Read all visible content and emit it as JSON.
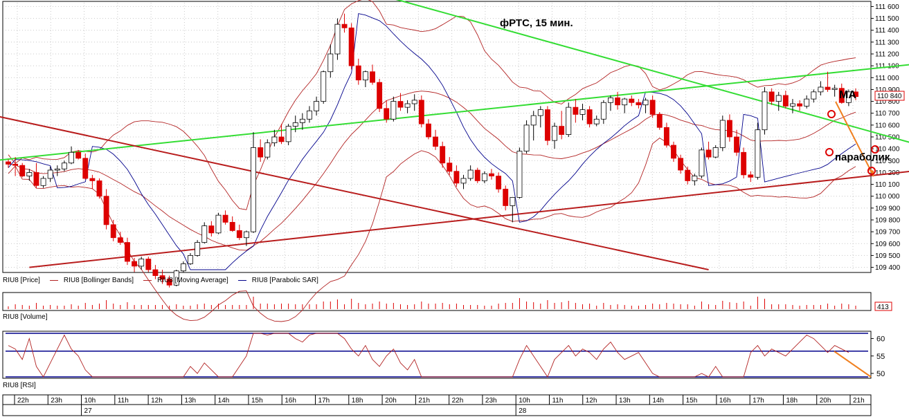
{
  "chart_title": "фРТС, 15 мин.",
  "annotations": {
    "ma": "MA",
    "parabolic": "параболик"
  },
  "price_panel": {
    "y_ticks": [
      "111 600",
      "111 500",
      "111 400",
      "111 300",
      "111 200",
      "111 100",
      "111 000",
      "110 900",
      "110 800",
      "110 700",
      "110 600",
      "110 500",
      "110 400",
      "110 300",
      "110 200",
      "110 100",
      "110 000",
      "109 900",
      "109 800",
      "109 700",
      "109 600",
      "109 500",
      "109 400"
    ],
    "last_price": "110 840",
    "legend": [
      {
        "label": "RIU8 [Price]",
        "color": "#000000"
      },
      {
        "label": "RIU8 [Bollinger Bands]",
        "color": "#b22222"
      },
      {
        "label": "RIU8 [Moving Average]",
        "color": "#b22222"
      },
      {
        "label": "RIU8 [Parabolic SAR]",
        "color": "#00008b"
      }
    ]
  },
  "volume_panel": {
    "label": "RIU8 [Volume]",
    "last_value": "413"
  },
  "rsi_panel": {
    "label": "RIU8 [RSI]",
    "y_ticks": [
      "60",
      "55",
      "50"
    ]
  },
  "time_axis": {
    "hours": [
      "22h",
      "23h",
      "10h",
      "11h",
      "12h",
      "13h",
      "14h",
      "15h",
      "16h",
      "17h",
      "18h",
      "20h",
      "21h",
      "22h",
      "23h",
      "10h",
      "11h",
      "12h",
      "13h",
      "14h",
      "15h",
      "16h",
      "17h",
      "18h",
      "20h",
      "21h"
    ],
    "days": [
      "27",
      "28"
    ]
  },
  "colors": {
    "up_candle": "#ffffff",
    "down_candle": "#dd0000",
    "bollinger": "#b22222",
    "sar": "#00008b",
    "trend_green": "#33dd33",
    "trend_red": "#b81c1c",
    "forecast": "#f08020",
    "rsi_line": "#b22222",
    "rsi_level": "#00008b"
  },
  "chart_data": {
    "type": "candlestick",
    "timeframe": "15 мин.",
    "ylim": [
      109380,
      111620
    ],
    "candles": [
      [
        110290,
        110310,
        110240,
        110270
      ],
      [
        110270,
        110330,
        110170,
        110260
      ],
      [
        110260,
        110280,
        110160,
        110170
      ],
      [
        110170,
        110230,
        110130,
        110200
      ],
      [
        110200,
        110280,
        110070,
        110090
      ],
      [
        110090,
        110170,
        110070,
        110150
      ],
      [
        110150,
        110250,
        110120,
        110220
      ],
      [
        110220,
        110260,
        110170,
        110230
      ],
      [
        110230,
        110300,
        110210,
        110280
      ],
      [
        110280,
        110420,
        110270,
        110370
      ],
      [
        110370,
        110390,
        110310,
        110320
      ],
      [
        110320,
        110360,
        110140,
        110150
      ],
      [
        110150,
        110180,
        110060,
        110130
      ],
      [
        110130,
        110150,
        109980,
        110000
      ],
      [
        110000,
        110060,
        109720,
        109760
      ],
      [
        109760,
        109800,
        109620,
        109650
      ],
      [
        109650,
        109700,
        109590,
        109610
      ],
      [
        109610,
        109650,
        109420,
        109450
      ],
      [
        109450,
        109480,
        109360,
        109410
      ],
      [
        109410,
        109490,
        109380,
        109470
      ],
      [
        109470,
        109490,
        109360,
        109380
      ],
      [
        109380,
        109420,
        109300,
        109330
      ],
      [
        109330,
        109380,
        109260,
        109300
      ],
      [
        109300,
        109330,
        109230,
        109250
      ],
      [
        109250,
        109380,
        109240,
        109370
      ],
      [
        109370,
        109450,
        109360,
        109430
      ],
      [
        109430,
        109520,
        109420,
        109500
      ],
      [
        109500,
        109630,
        109490,
        109610
      ],
      [
        109610,
        109780,
        109600,
        109750
      ],
      [
        109750,
        109790,
        109660,
        109690
      ],
      [
        109690,
        109860,
        109680,
        109840
      ],
      [
        109840,
        109880,
        109760,
        109780
      ],
      [
        109780,
        109830,
        109700,
        109710
      ],
      [
        109710,
        109760,
        109630,
        109650
      ],
      [
        109650,
        109710,
        109580,
        109700
      ],
      [
        109700,
        110540,
        109690,
        110410
      ],
      [
        110410,
        110480,
        110290,
        110330
      ],
      [
        110330,
        110480,
        110310,
        110450
      ],
      [
        110450,
        110560,
        110420,
        110500
      ],
      [
        110500,
        110610,
        110440,
        110460
      ],
      [
        110460,
        110610,
        110430,
        110590
      ],
      [
        110590,
        110680,
        110540,
        110620
      ],
      [
        110620,
        110700,
        110560,
        110650
      ],
      [
        110650,
        110760,
        110620,
        110720
      ],
      [
        110720,
        110840,
        110680,
        110800
      ],
      [
        110800,
        111060,
        110780,
        111050
      ],
      [
        111050,
        111280,
        111000,
        111200
      ],
      [
        111200,
        111500,
        111150,
        111450
      ],
      [
        111450,
        111540,
        111380,
        111420
      ],
      [
        111420,
        111460,
        111070,
        111100
      ],
      [
        111100,
        111160,
        110940,
        110980
      ],
      [
        110980,
        111060,
        110920,
        111050
      ],
      [
        111050,
        111110,
        110940,
        110960
      ],
      [
        110960,
        110990,
        110710,
        110740
      ],
      [
        110740,
        110810,
        110620,
        110650
      ],
      [
        110650,
        110840,
        110630,
        110800
      ],
      [
        110800,
        110870,
        110720,
        110750
      ],
      [
        110750,
        110810,
        110700,
        110780
      ],
      [
        110780,
        110860,
        110720,
        110810
      ],
      [
        110810,
        110850,
        110580,
        110610
      ],
      [
        110610,
        110650,
        110480,
        110500
      ],
      [
        110500,
        110560,
        110390,
        110420
      ],
      [
        110420,
        110460,
        110240,
        110280
      ],
      [
        110280,
        110330,
        110180,
        110210
      ],
      [
        110210,
        110260,
        110080,
        110110
      ],
      [
        110110,
        110180,
        110060,
        110150
      ],
      [
        110150,
        110260,
        110130,
        110220
      ],
      [
        110220,
        110240,
        110110,
        110130
      ],
      [
        110130,
        110210,
        110110,
        110190
      ],
      [
        110190,
        110230,
        110140,
        110170
      ],
      [
        110170,
        110200,
        110030,
        110060
      ],
      [
        110060,
        110090,
        109880,
        109920
      ],
      [
        109920,
        109980,
        109780,
        109990
      ],
      [
        109990,
        110410,
        109980,
        110380
      ],
      [
        110380,
        110640,
        110360,
        110600
      ],
      [
        110600,
        110720,
        110470,
        110680
      ],
      [
        110680,
        110760,
        110580,
        110730
      ],
      [
        110730,
        110760,
        110430,
        110470
      ],
      [
        110470,
        110620,
        110400,
        110590
      ],
      [
        110590,
        110720,
        110480,
        110520
      ],
      [
        110520,
        110790,
        110500,
        110750
      ],
      [
        110750,
        110820,
        110620,
        110690
      ],
      [
        110690,
        110780,
        110640,
        110730
      ],
      [
        110730,
        110760,
        110580,
        110610
      ],
      [
        110610,
        110680,
        110590,
        110650
      ],
      [
        110650,
        110810,
        110610,
        110790
      ],
      [
        110790,
        110850,
        110720,
        110830
      ],
      [
        110830,
        110880,
        110730,
        110770
      ],
      [
        110770,
        110830,
        110700,
        110820
      ],
      [
        110820,
        110850,
        110760,
        110790
      ],
      [
        110790,
        110820,
        110740,
        110770
      ],
      [
        110770,
        110830,
        110700,
        110810
      ],
      [
        110810,
        110850,
        110660,
        110690
      ],
      [
        110690,
        110710,
        110560,
        110580
      ],
      [
        110580,
        110620,
        110410,
        110430
      ],
      [
        110430,
        110460,
        110290,
        110320
      ],
      [
        110320,
        110350,
        110190,
        110220
      ],
      [
        110220,
        110250,
        110100,
        110130
      ],
      [
        110130,
        110190,
        110090,
        110170
      ],
      [
        110170,
        110410,
        110150,
        110390
      ],
      [
        110390,
        110460,
        110310,
        110330
      ],
      [
        110330,
        110430,
        110320,
        110410
      ],
      [
        110410,
        110680,
        110380,
        110640
      ],
      [
        110640,
        110690,
        110460,
        110500
      ],
      [
        110500,
        110560,
        110340,
        110370
      ],
      [
        110370,
        110410,
        110150,
        110180
      ],
      [
        110180,
        110210,
        110120,
        110160
      ],
      [
        110160,
        110620,
        110140,
        110560
      ],
      [
        110560,
        110920,
        110520,
        110880
      ],
      [
        110880,
        110910,
        110770,
        110800
      ],
      [
        110800,
        110880,
        110720,
        110850
      ],
      [
        110850,
        110890,
        110740,
        110760
      ],
      [
        110760,
        110820,
        110700,
        110780
      ],
      [
        110780,
        110810,
        110720,
        110760
      ],
      [
        110760,
        110850,
        110740,
        110820
      ],
      [
        110820,
        110900,
        110790,
        110880
      ],
      [
        110880,
        110970,
        110850,
        110920
      ],
      [
        110920,
        111050,
        110880,
        110900
      ],
      [
        110900,
        110940,
        110840,
        110910
      ],
      [
        110910,
        110950,
        110780,
        110790
      ],
      [
        110790,
        110900,
        110760,
        110880
      ],
      [
        110880,
        110910,
        110810,
        110840
      ]
    ],
    "trendlines": [
      {
        "color": "green",
        "from": [
          -2,
          110300
        ],
        "to": [
          132,
          111130
        ]
      },
      {
        "color": "green",
        "from": [
          42,
          111880
        ],
        "to": [
          132,
          110400
        ]
      },
      {
        "color": "red",
        "from": [
          -2,
          110680
        ],
        "to": [
          100,
          109380
        ]
      },
      {
        "color": "red",
        "from": [
          3,
          109400
        ],
        "to": [
          132,
          110230
        ]
      }
    ],
    "rsi": [
      58,
      57,
      54,
      60,
      52,
      49,
      53,
      57,
      61,
      57,
      55,
      51,
      48,
      45,
      42,
      40,
      41,
      39,
      38,
      40,
      37,
      36,
      38,
      41,
      45,
      49,
      52,
      50,
      53,
      51,
      49,
      46,
      48,
      52,
      55,
      62,
      63,
      61,
      64,
      62,
      63,
      60,
      59,
      61,
      63,
      62,
      64,
      62,
      60,
      57,
      55,
      58,
      54,
      52,
      55,
      57,
      53,
      51,
      54,
      49,
      45,
      47,
      44,
      42,
      41,
      45,
      47,
      44,
      46,
      44,
      42,
      39,
      41,
      54,
      58,
      55,
      52,
      49,
      54,
      56,
      58,
      55,
      57,
      56,
      54,
      57,
      59,
      56,
      54,
      55,
      56,
      53,
      50,
      48,
      45,
      42,
      44,
      48,
      46,
      50,
      49,
      52,
      48,
      45,
      43,
      47,
      56,
      58,
      55,
      57,
      56,
      55,
      57,
      59,
      61,
      60,
      58,
      56,
      58,
      57,
      56
    ]
  }
}
